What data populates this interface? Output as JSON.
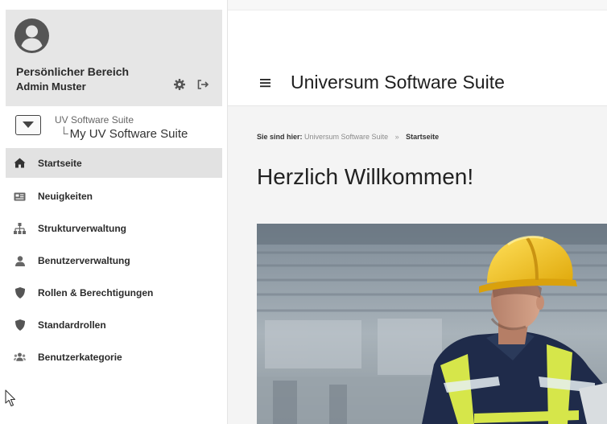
{
  "profile": {
    "title": "Persönlicher Bereich",
    "user": "Admin Muster",
    "icons": [
      "user-avatar-icon",
      "gear-icon",
      "logout-icon"
    ]
  },
  "app_switch": {
    "parent": "UV Software Suite",
    "tree_glyph": "└",
    "current": "My UV Software Suite"
  },
  "nav": {
    "items": [
      {
        "label": "Startseite",
        "icon": "home-icon",
        "active": true
      },
      {
        "label": "Neuigkeiten",
        "icon": "news-icon"
      },
      {
        "label": "Strukturverwaltung",
        "icon": "sitemap-icon"
      },
      {
        "label": "Benutzerverwaltung",
        "icon": "user-icon"
      },
      {
        "label": "Rollen & Berechtigungen",
        "icon": "shield-icon"
      },
      {
        "label": "Standardrollen",
        "icon": "shield-icon"
      },
      {
        "label": "Benutzerkategorie",
        "icon": "users-icon"
      }
    ]
  },
  "header": {
    "menu_glyph": "≡",
    "title": "Universum Software Suite"
  },
  "breadcrumb": {
    "label": "Sie sind hier:",
    "link": "Universum Software Suite",
    "separator": "»",
    "current": "Startseite"
  },
  "main": {
    "heading": "Herzlich Willkommen!",
    "hero_image": "construction-worker-photo"
  },
  "colors": {
    "sidebar_profile_bg": "#e6e6e6",
    "active_item_bg": "#e2e2e2",
    "content_bg": "#f4f4f4",
    "text": "#2b2b2b",
    "helmet_yellow": "#f3c21a",
    "jacket_navy": "#1f2b4a",
    "reflective_yellow": "#d6e64a"
  }
}
